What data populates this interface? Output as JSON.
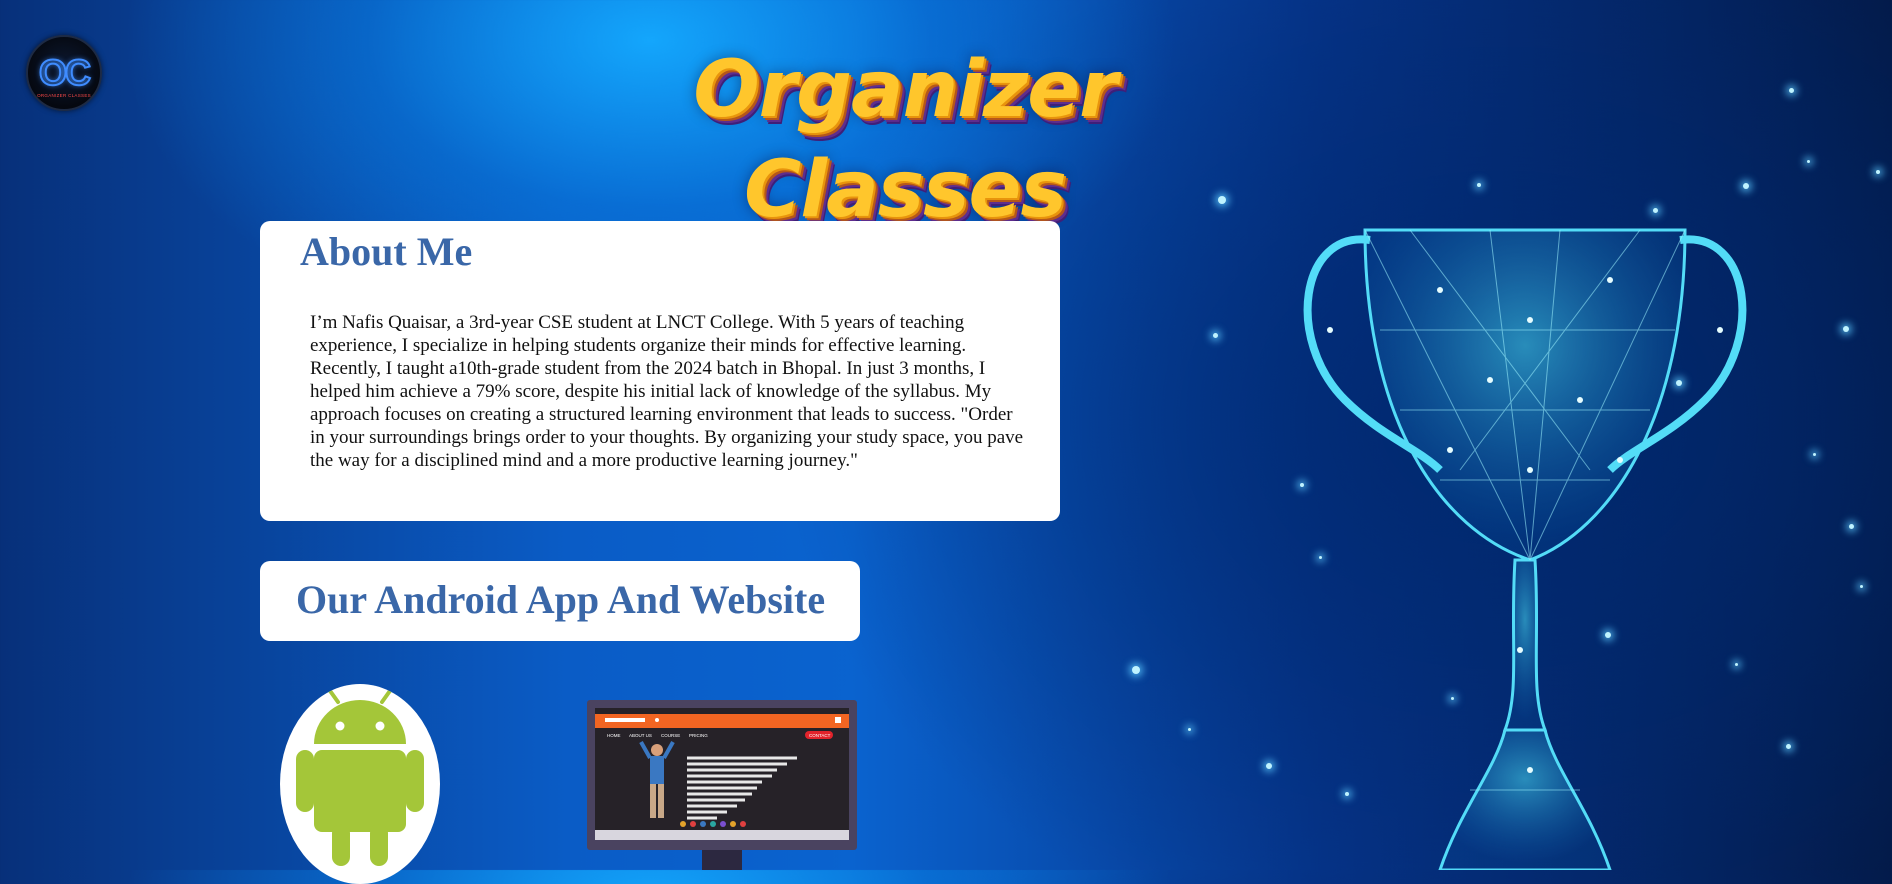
{
  "logo": {
    "monogram": "OC",
    "tagline": "ORGANIZER CLASSES"
  },
  "header": {
    "title": "Organizer Classes"
  },
  "about": {
    "heading": "About Me",
    "body": "I’m Nafis Quaisar, a 3rd-year CSE student at LNCT College. With 5 years of teaching experience, I specialize in helping students organize their minds for effective learning. Recently, I taught a10th-grade student from the 2024 batch in Bhopal. In just 3 months, I helped him achieve a 79% score, despite his initial lack of knowledge of the syllabus. My approach focuses on creating a structured learning environment that leads to success. \"Order in your surroundings brings order to your thoughts. By organizing your study space, you pave the way for a disciplined mind and a more productive learning journey.\""
  },
  "apps": {
    "heading": "Our Android App And Website",
    "android_icon": "android-robot-icon",
    "website_preview": {
      "nav_items": [
        "HOME",
        "ABOUT US",
        "COURSE",
        "PRICING"
      ],
      "cta": "CONTACT"
    }
  },
  "decor": {
    "trophy": "trophy-icon"
  },
  "colors": {
    "heading_blue": "#3a67a8",
    "title_gold": "#ffc62c",
    "android_green": "#a4c639",
    "website_orange": "#f26522"
  }
}
